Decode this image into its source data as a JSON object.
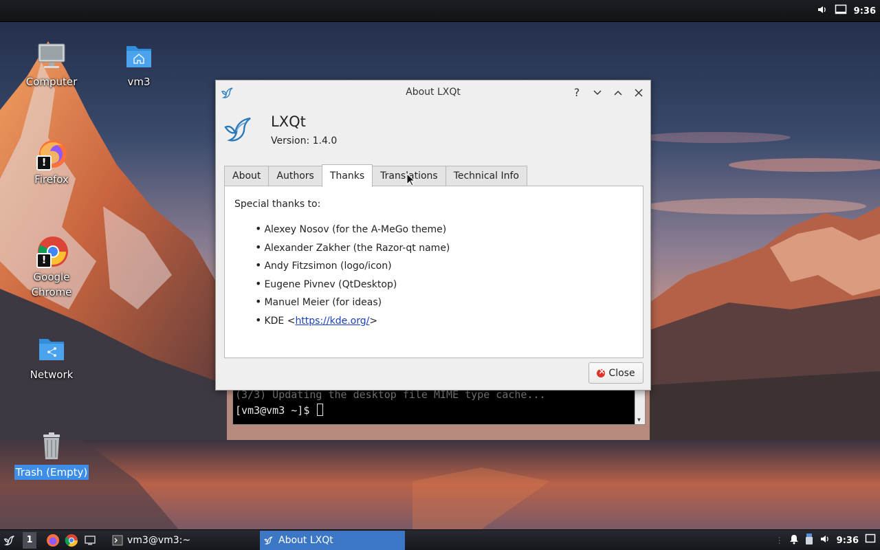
{
  "top_panel": {
    "clock": "9:36"
  },
  "desktop_icons": [
    {
      "label": "Computer"
    },
    {
      "label": "vm3"
    },
    {
      "label": "Firefox",
      "badge": "!"
    },
    {
      "label": "Google Chrome",
      "label_line1": "Google",
      "label_line2": "Chrome",
      "badge": "!"
    },
    {
      "label": "Network"
    },
    {
      "label": "Trash (Empty)"
    }
  ],
  "terminal": {
    "line1": "(3/3) Updating the desktop file MIME type cache...",
    "prompt": "[vm3@vm3 ~]$ "
  },
  "dialog": {
    "title": "About LXQt",
    "titlebar_buttons": {
      "help": "?"
    },
    "app_name": "LXQt",
    "version": "Version: 1.4.0",
    "tabs": [
      {
        "label": "About",
        "active": false
      },
      {
        "label": "Authors",
        "active": false
      },
      {
        "label": "Thanks",
        "active": true
      },
      {
        "label": "Translations",
        "active": false
      },
      {
        "label": "Technical Info",
        "active": false
      }
    ],
    "thanks": {
      "heading": "Special thanks to:",
      "items": [
        "Alexey Nosov (for the A-MeGo theme)",
        "Alexander Zakher (the Razor-qt name)",
        "Andy Fitzsimon (logo/icon)",
        "Eugene Pivnev (QtDesktop)",
        "Manuel Meier (for ideas)"
      ],
      "kde": {
        "prefix": "KDE <",
        "link": "https://kde.org/",
        "suffix": ">"
      }
    },
    "close_label": "Close"
  },
  "taskbar": {
    "desktop_number": "1",
    "tasks": [
      {
        "label": "vm3@vm3:~",
        "active": false
      },
      {
        "label": "About LXQt",
        "active": true
      }
    ],
    "clock": "9:36"
  },
  "colors": {
    "selection": "#3d8ee6",
    "active_task": "#3b77c4",
    "link": "#1a3fbf",
    "close_icon": "#e0312b"
  }
}
